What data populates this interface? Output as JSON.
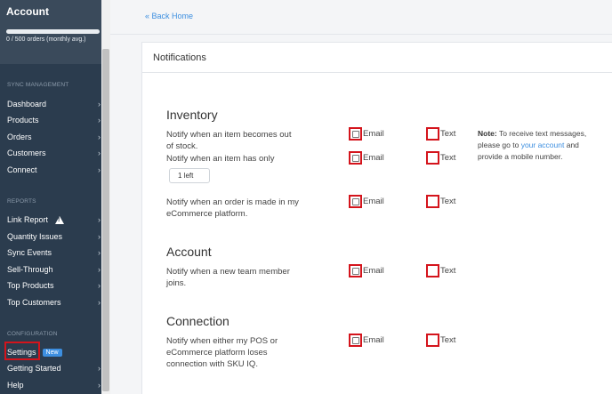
{
  "sidebar": {
    "account_title": "Account",
    "usage_text": "0 / 500 orders (monthly avg.)",
    "usage_fraction": 0,
    "sync_label": "SYNC MANAGEMENT",
    "sync_items": [
      "Dashboard",
      "Products",
      "Orders",
      "Customers",
      "Connect"
    ],
    "reports_label": "REPORTS",
    "report_items": [
      "Link Report",
      "Quantity Issues",
      "Sync Events",
      "Sell-Through",
      "Top Products",
      "Top Customers"
    ],
    "config_label": "CONFIGURATION",
    "config_items": [
      "Settings",
      "Getting Started",
      "Help"
    ],
    "new_badge": "New",
    "chevron": "›"
  },
  "main": {
    "back_link": "« Back Home",
    "card_title": "Notifications",
    "select_value": "1 left",
    "email_label": "Email",
    "text_label": "Text",
    "sections": {
      "inventory": {
        "title": "Inventory",
        "row1": "Notify when an item becomes out of stock.",
        "row2": "Notify when an item has only",
        "row3": "Notify when an order is made in my eCommerce platform."
      },
      "account": {
        "title": "Account",
        "row1": "Notify when a new team member joins."
      },
      "connection": {
        "title": "Connection",
        "row1": "Notify when either my POS or eCommerce platform loses connection with SKU IQ."
      }
    },
    "note": {
      "bold": "Note:",
      "before_link": " To receive text messages, please go to ",
      "link": "your account",
      "after_link": " and provide a mobile number."
    }
  },
  "colors": {
    "sidebar_bg": "#2b3c4e",
    "highlight_red": "#d4141c",
    "link_blue": "#3d8fe0"
  }
}
